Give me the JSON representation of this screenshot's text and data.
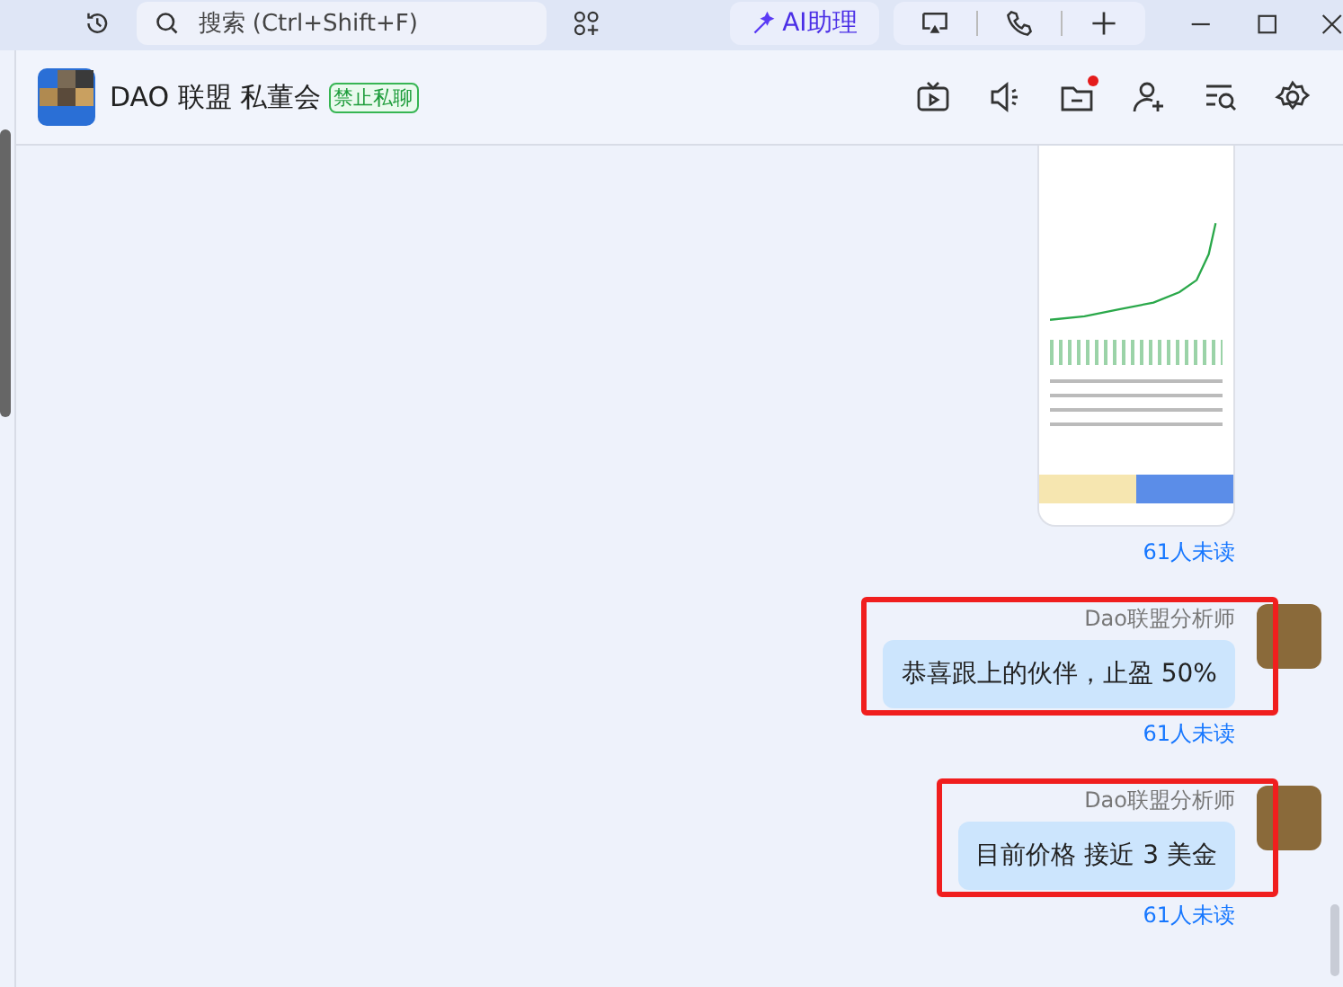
{
  "top_bar": {
    "search": {
      "placeholder": "搜索 (Ctrl+Shift+F)"
    },
    "ai_button": "AI助理"
  },
  "header": {
    "title": "DAO 联盟 私董会",
    "badge": "禁止私聊",
    "file_notice": true
  },
  "messages": [
    {
      "kind": "image",
      "read_status": "61人未读"
    },
    {
      "kind": "text",
      "sender": "Dao联盟分析师",
      "text": "恭喜跟上的伙伴，止盈 50%",
      "read_status": "61人未读",
      "highlighted": true
    },
    {
      "kind": "text",
      "sender": "Dao联盟分析师",
      "text": "目前价格 接近 3 美金",
      "read_status": "61人未读",
      "highlighted": true
    }
  ]
}
